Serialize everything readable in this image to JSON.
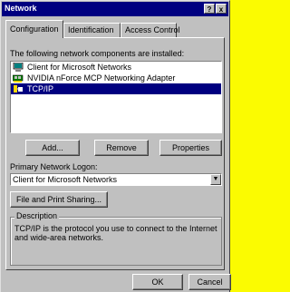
{
  "window": {
    "title": "Network",
    "help_glyph": "?",
    "close_glyph": "x"
  },
  "tabs": [
    {
      "label": "Configuration",
      "active": true
    },
    {
      "label": "Identification",
      "active": false
    },
    {
      "label": "Access Control",
      "active": false
    }
  ],
  "components": {
    "label": "The following network components are installed:",
    "items": [
      {
        "label": "Client for Microsoft Networks",
        "icon": "client-icon",
        "selected": false
      },
      {
        "label": "NVIDIA nForce MCP Networking Adapter",
        "icon": "adapter-icon",
        "selected": false
      },
      {
        "label": "TCP/IP",
        "icon": "protocol-icon",
        "selected": true
      }
    ]
  },
  "buttons": {
    "add": "Add...",
    "remove": "Remove",
    "properties": "Properties"
  },
  "logon": {
    "label": "Primary Network Logon:",
    "value": "Client for Microsoft Networks"
  },
  "sharing_button": "File and Print Sharing...",
  "description": {
    "title": "Description",
    "text": "TCP/IP is the protocol you use to connect to the Internet and wide-area networks."
  },
  "footer": {
    "ok": "OK",
    "cancel": "Cancel"
  },
  "colors": {
    "titlebar": "#000080",
    "selection": "#000080",
    "face": "#c0c0c0",
    "desktop": "#fbfb01"
  }
}
